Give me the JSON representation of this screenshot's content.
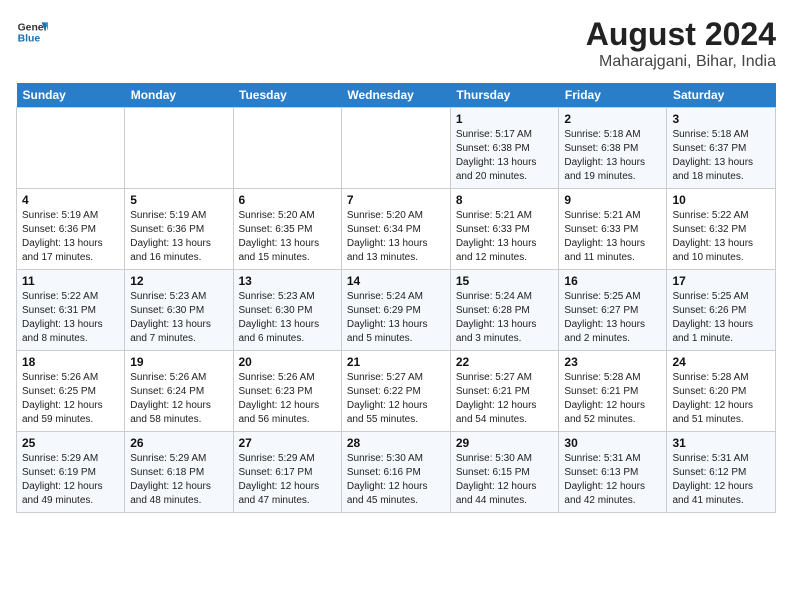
{
  "header": {
    "logo_line1": "General",
    "logo_line2": "Blue",
    "title": "August 2024",
    "subtitle": "Maharajgani, Bihar, India"
  },
  "columns": [
    "Sunday",
    "Monday",
    "Tuesday",
    "Wednesday",
    "Thursday",
    "Friday",
    "Saturday"
  ],
  "weeks": [
    [
      {
        "day": "",
        "info": ""
      },
      {
        "day": "",
        "info": ""
      },
      {
        "day": "",
        "info": ""
      },
      {
        "day": "",
        "info": ""
      },
      {
        "day": "1",
        "info": "Sunrise: 5:17 AM\nSunset: 6:38 PM\nDaylight: 13 hours\nand 20 minutes."
      },
      {
        "day": "2",
        "info": "Sunrise: 5:18 AM\nSunset: 6:38 PM\nDaylight: 13 hours\nand 19 minutes."
      },
      {
        "day": "3",
        "info": "Sunrise: 5:18 AM\nSunset: 6:37 PM\nDaylight: 13 hours\nand 18 minutes."
      }
    ],
    [
      {
        "day": "4",
        "info": "Sunrise: 5:19 AM\nSunset: 6:36 PM\nDaylight: 13 hours\nand 17 minutes."
      },
      {
        "day": "5",
        "info": "Sunrise: 5:19 AM\nSunset: 6:36 PM\nDaylight: 13 hours\nand 16 minutes."
      },
      {
        "day": "6",
        "info": "Sunrise: 5:20 AM\nSunset: 6:35 PM\nDaylight: 13 hours\nand 15 minutes."
      },
      {
        "day": "7",
        "info": "Sunrise: 5:20 AM\nSunset: 6:34 PM\nDaylight: 13 hours\nand 13 minutes."
      },
      {
        "day": "8",
        "info": "Sunrise: 5:21 AM\nSunset: 6:33 PM\nDaylight: 13 hours\nand 12 minutes."
      },
      {
        "day": "9",
        "info": "Sunrise: 5:21 AM\nSunset: 6:33 PM\nDaylight: 13 hours\nand 11 minutes."
      },
      {
        "day": "10",
        "info": "Sunrise: 5:22 AM\nSunset: 6:32 PM\nDaylight: 13 hours\nand 10 minutes."
      }
    ],
    [
      {
        "day": "11",
        "info": "Sunrise: 5:22 AM\nSunset: 6:31 PM\nDaylight: 13 hours\nand 8 minutes."
      },
      {
        "day": "12",
        "info": "Sunrise: 5:23 AM\nSunset: 6:30 PM\nDaylight: 13 hours\nand 7 minutes."
      },
      {
        "day": "13",
        "info": "Sunrise: 5:23 AM\nSunset: 6:30 PM\nDaylight: 13 hours\nand 6 minutes."
      },
      {
        "day": "14",
        "info": "Sunrise: 5:24 AM\nSunset: 6:29 PM\nDaylight: 13 hours\nand 5 minutes."
      },
      {
        "day": "15",
        "info": "Sunrise: 5:24 AM\nSunset: 6:28 PM\nDaylight: 13 hours\nand 3 minutes."
      },
      {
        "day": "16",
        "info": "Sunrise: 5:25 AM\nSunset: 6:27 PM\nDaylight: 13 hours\nand 2 minutes."
      },
      {
        "day": "17",
        "info": "Sunrise: 5:25 AM\nSunset: 6:26 PM\nDaylight: 13 hours\nand 1 minute."
      }
    ],
    [
      {
        "day": "18",
        "info": "Sunrise: 5:26 AM\nSunset: 6:25 PM\nDaylight: 12 hours\nand 59 minutes."
      },
      {
        "day": "19",
        "info": "Sunrise: 5:26 AM\nSunset: 6:24 PM\nDaylight: 12 hours\nand 58 minutes."
      },
      {
        "day": "20",
        "info": "Sunrise: 5:26 AM\nSunset: 6:23 PM\nDaylight: 12 hours\nand 56 minutes."
      },
      {
        "day": "21",
        "info": "Sunrise: 5:27 AM\nSunset: 6:22 PM\nDaylight: 12 hours\nand 55 minutes."
      },
      {
        "day": "22",
        "info": "Sunrise: 5:27 AM\nSunset: 6:21 PM\nDaylight: 12 hours\nand 54 minutes."
      },
      {
        "day": "23",
        "info": "Sunrise: 5:28 AM\nSunset: 6:21 PM\nDaylight: 12 hours\nand 52 minutes."
      },
      {
        "day": "24",
        "info": "Sunrise: 5:28 AM\nSunset: 6:20 PM\nDaylight: 12 hours\nand 51 minutes."
      }
    ],
    [
      {
        "day": "25",
        "info": "Sunrise: 5:29 AM\nSunset: 6:19 PM\nDaylight: 12 hours\nand 49 minutes."
      },
      {
        "day": "26",
        "info": "Sunrise: 5:29 AM\nSunset: 6:18 PM\nDaylight: 12 hours\nand 48 minutes."
      },
      {
        "day": "27",
        "info": "Sunrise: 5:29 AM\nSunset: 6:17 PM\nDaylight: 12 hours\nand 47 minutes."
      },
      {
        "day": "28",
        "info": "Sunrise: 5:30 AM\nSunset: 6:16 PM\nDaylight: 12 hours\nand 45 minutes."
      },
      {
        "day": "29",
        "info": "Sunrise: 5:30 AM\nSunset: 6:15 PM\nDaylight: 12 hours\nand 44 minutes."
      },
      {
        "day": "30",
        "info": "Sunrise: 5:31 AM\nSunset: 6:13 PM\nDaylight: 12 hours\nand 42 minutes."
      },
      {
        "day": "31",
        "info": "Sunrise: 5:31 AM\nSunset: 6:12 PM\nDaylight: 12 hours\nand 41 minutes."
      }
    ]
  ]
}
